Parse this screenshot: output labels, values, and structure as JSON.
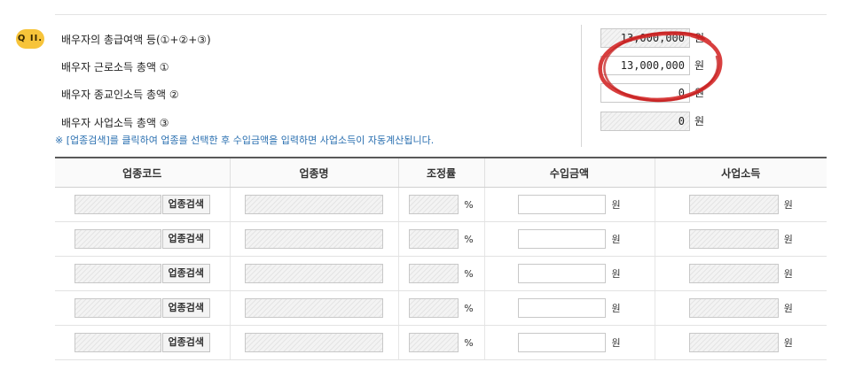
{
  "question": {
    "badge": "Q II.",
    "lines": [
      {
        "label": "배우자의 총급여액 등(①+②+③)",
        "value": "13,000,000",
        "unit": "원"
      },
      {
        "label": "배우자 근로소득 총액 ①",
        "value": "13,000,000",
        "unit": "원"
      },
      {
        "label": "배우자 종교인소득 총액 ②",
        "value": "0",
        "unit": "원"
      },
      {
        "label": "배우자 사업소득 총액 ③",
        "value": "0",
        "unit": "원"
      }
    ],
    "note": "※ [업종검색]를 클릭하여 업종를 선택한 후 수입금액을 입력하면 사업소득이 자동계산됩니다."
  },
  "table": {
    "headers": [
      "업종코드",
      "업종명",
      "조정률",
      "수입금액",
      "사업소득"
    ],
    "search_label": "업종검색",
    "percent_unit": "%",
    "won_unit": "원",
    "rows": 5
  },
  "colors": {
    "badge": "#f7c43a",
    "note": "#2a6fb0",
    "annotation": "#d42a2a"
  }
}
